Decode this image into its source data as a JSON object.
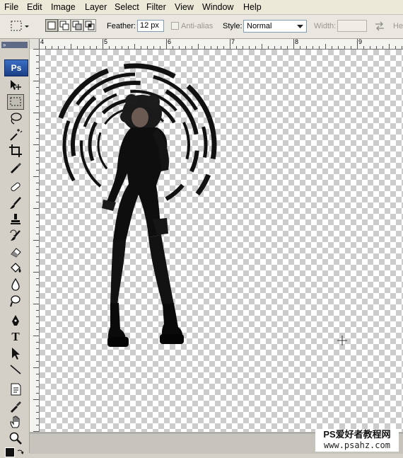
{
  "menu": [
    "File",
    "Edit",
    "Image",
    "Layer",
    "Select",
    "Filter",
    "View",
    "Window",
    "Help"
  ],
  "options": {
    "feather_label": "Feather:",
    "feather_value": "12 px",
    "antialias_label": "Anti-alias",
    "style_label": "Style:",
    "style_value": "Normal",
    "width_label": "Width:",
    "height_label": "He"
  },
  "app_logo": "Ps",
  "ruler": {
    "ticks": [
      "4",
      "5",
      "6",
      "7",
      "8",
      "9"
    ]
  },
  "tools": [
    "move-icon",
    "marquee-icon",
    "lasso-icon",
    "magic-wand-icon",
    "crop-icon",
    "eyedropper-icon",
    "healing-brush-icon",
    "brush-icon",
    "clone-stamp-icon",
    "history-brush-icon",
    "eraser-icon",
    "paint-bucket-icon",
    "blur-icon",
    "dodge-icon",
    "pen-icon",
    "type-icon",
    "path-select-icon",
    "line-icon",
    "notes-icon",
    "eyedropper2-icon",
    "hand-icon",
    "zoom-icon"
  ],
  "watermark": {
    "line1": "PS爱好者教程网",
    "line2": "www.psahz.com"
  },
  "colors": {
    "menubar": "#ece9d8",
    "toolbar": "#d4d0c8",
    "checker": "#cccccc"
  }
}
